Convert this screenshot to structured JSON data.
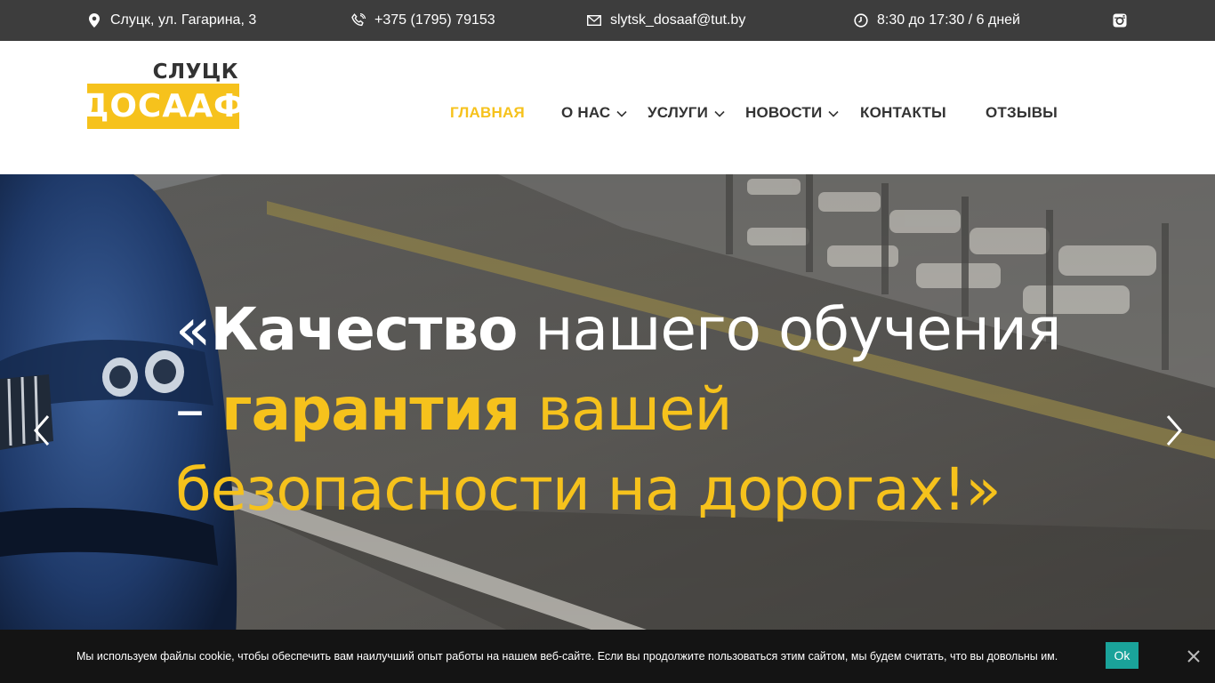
{
  "topbar": {
    "address": {
      "icon": "map-marker-icon",
      "text": "Слуцк, ул. Гагарина, 3"
    },
    "phone": {
      "icon": "phone-icon",
      "text": "+375 (1795) 79153"
    },
    "email": {
      "icon": "envelope-icon",
      "text": "slytsk_dosaaf@tut.by"
    },
    "hours": {
      "icon": "clock-icon",
      "text": "8:30 до 17:30 / 6 дней"
    },
    "social": {
      "icon": "instagram-icon"
    }
  },
  "logo": {
    "top": "СЛУЦК",
    "main": "ДОСААФ"
  },
  "nav": {
    "items": [
      {
        "label": "ГЛАВНАЯ",
        "active": true,
        "dropdown": false
      },
      {
        "label": "О НАС",
        "active": false,
        "dropdown": true
      },
      {
        "label": "УСЛУГИ",
        "active": false,
        "dropdown": true
      },
      {
        "label": "НОВОСТИ",
        "active": false,
        "dropdown": true
      },
      {
        "label": "КОНТАКТЫ",
        "active": false,
        "dropdown": false
      },
      {
        "label": "ОТЗЫВЫ",
        "active": false,
        "dropdown": false
      }
    ]
  },
  "hero": {
    "open_quote": "«",
    "word_bold": "Качество",
    "part1": " нашего обучения – ",
    "word_yellow_bold": "гарантия",
    "part2": " вашей безопасности на дорогах!»",
    "prev_icon": "chevron-left-icon",
    "next_icon": "chevron-right-icon"
  },
  "cookie": {
    "text": "Мы используем файлы cookie, чтобы обеспечить вам наилучший опыт работы на нашем веб-сайте. Если вы продолжите пользоваться этим сайтом, мы будем считать, что вы довольны им.",
    "ok_label": "Ok",
    "close_icon": "close-icon"
  },
  "colors": {
    "accent": "#f6c21c",
    "topbar": "#3d3d3d",
    "cookie_bg": "#141414",
    "ok_button": "#1aa39a"
  }
}
